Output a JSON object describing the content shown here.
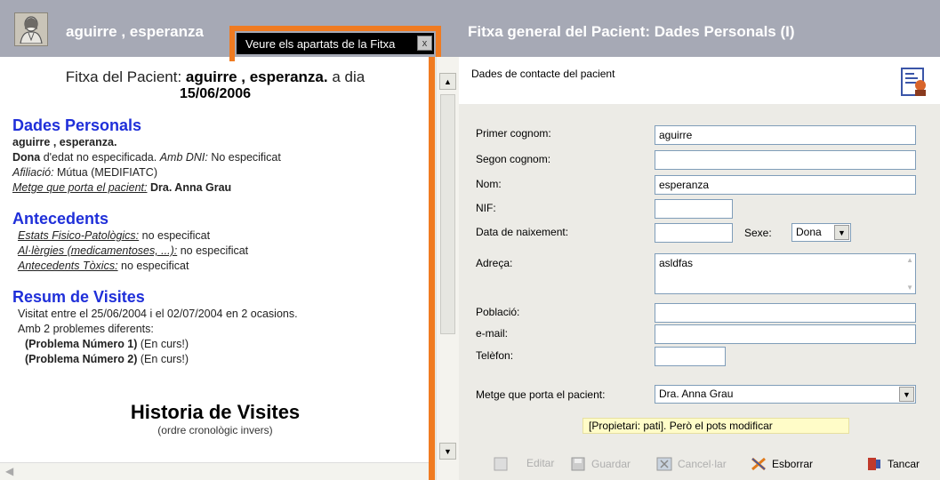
{
  "header": {
    "patient_name": "aguirre , esperanza",
    "right_title": "Fitxa general del Pacient: Dades Personals (I)",
    "tab_label": "Veure els apartats de la Fitxa",
    "tab_close": "x"
  },
  "left": {
    "intro": "Fitxa del Pacient: ",
    "intro_name": "aguirre , esperanza.",
    "intro_suffix": " a dia",
    "date": "15/06/2006",
    "dades": {
      "title": "Dades Personals",
      "name_line": "aguirre , esperanza.",
      "dona_label": "Dona",
      "dona_text": " d'edat no especificada. ",
      "dni_label": "Amb DNI:",
      "dni_text": " No especificat",
      "afiliacio_label": "Afiliació:",
      "afiliacio_text": " Mútua (MEDIFIATC)",
      "metge_label": "Metge que porta el pacient:",
      "metge_text": " Dra. Anna Grau"
    },
    "antecedents": {
      "title": "Antecedents",
      "items": [
        {
          "label": "Estats Fisico-Patològics:",
          "text": " no especificat"
        },
        {
          "label": "Al·lèrgies (medicamentoses, ...):",
          "text": " no especificat"
        },
        {
          "label": "Antecedents Tòxics:",
          "text": " no especificat"
        }
      ]
    },
    "resum": {
      "title": "Resum de Visites",
      "line1": "Visitat entre el 25/06/2004 i el 02/07/2004 en 2 ocasions.",
      "line2": "Amb 2 problemes diferents:",
      "problem1_label": "(Problema Número 1)",
      "problem1_status": " (En curs!)",
      "problem2_label": "(Problema Número 2)",
      "problem2_status": " (En curs!)"
    },
    "historia_title": "Historia de Visites",
    "historia_sub": "(ordre cronològic invers)"
  },
  "right": {
    "contact_title": "Dades de contacte del pacient",
    "fields": {
      "primer_cognom_label": "Primer cognom:",
      "primer_cognom_value": "aguirre",
      "segon_cognom_label": "Segon cognom:",
      "segon_cognom_value": "",
      "nom_label": "Nom:",
      "nom_value": "esperanza",
      "nif_label": "NIF:",
      "nif_value": "",
      "data_label": "Data de naixement:",
      "data_value": "",
      "sexe_label": "Sexe:",
      "sexe_value": "Dona",
      "adreca_label": "Adreça:",
      "adreca_value": "asldfas",
      "poblacio_label": "Població:",
      "poblacio_value": "",
      "email_label": "e-mail:",
      "email_value": "",
      "telefon_label": "Telèfon:",
      "telefon_value": "",
      "metge_label": "Metge que porta el pacient:",
      "metge_value": "Dra. Anna Grau"
    },
    "note": "[Propietari: pati]. Però el pots modificar",
    "toolbar": {
      "editar": "Editar",
      "guardar": "Guardar",
      "cancelar": "Cancel·lar",
      "esborrar": "Esborrar",
      "tancar": "Tancar"
    }
  },
  "colors": {
    "highlight": "#f07b21",
    "section_title": "#1f2fd9",
    "header_bg": "#a6a9b5"
  }
}
